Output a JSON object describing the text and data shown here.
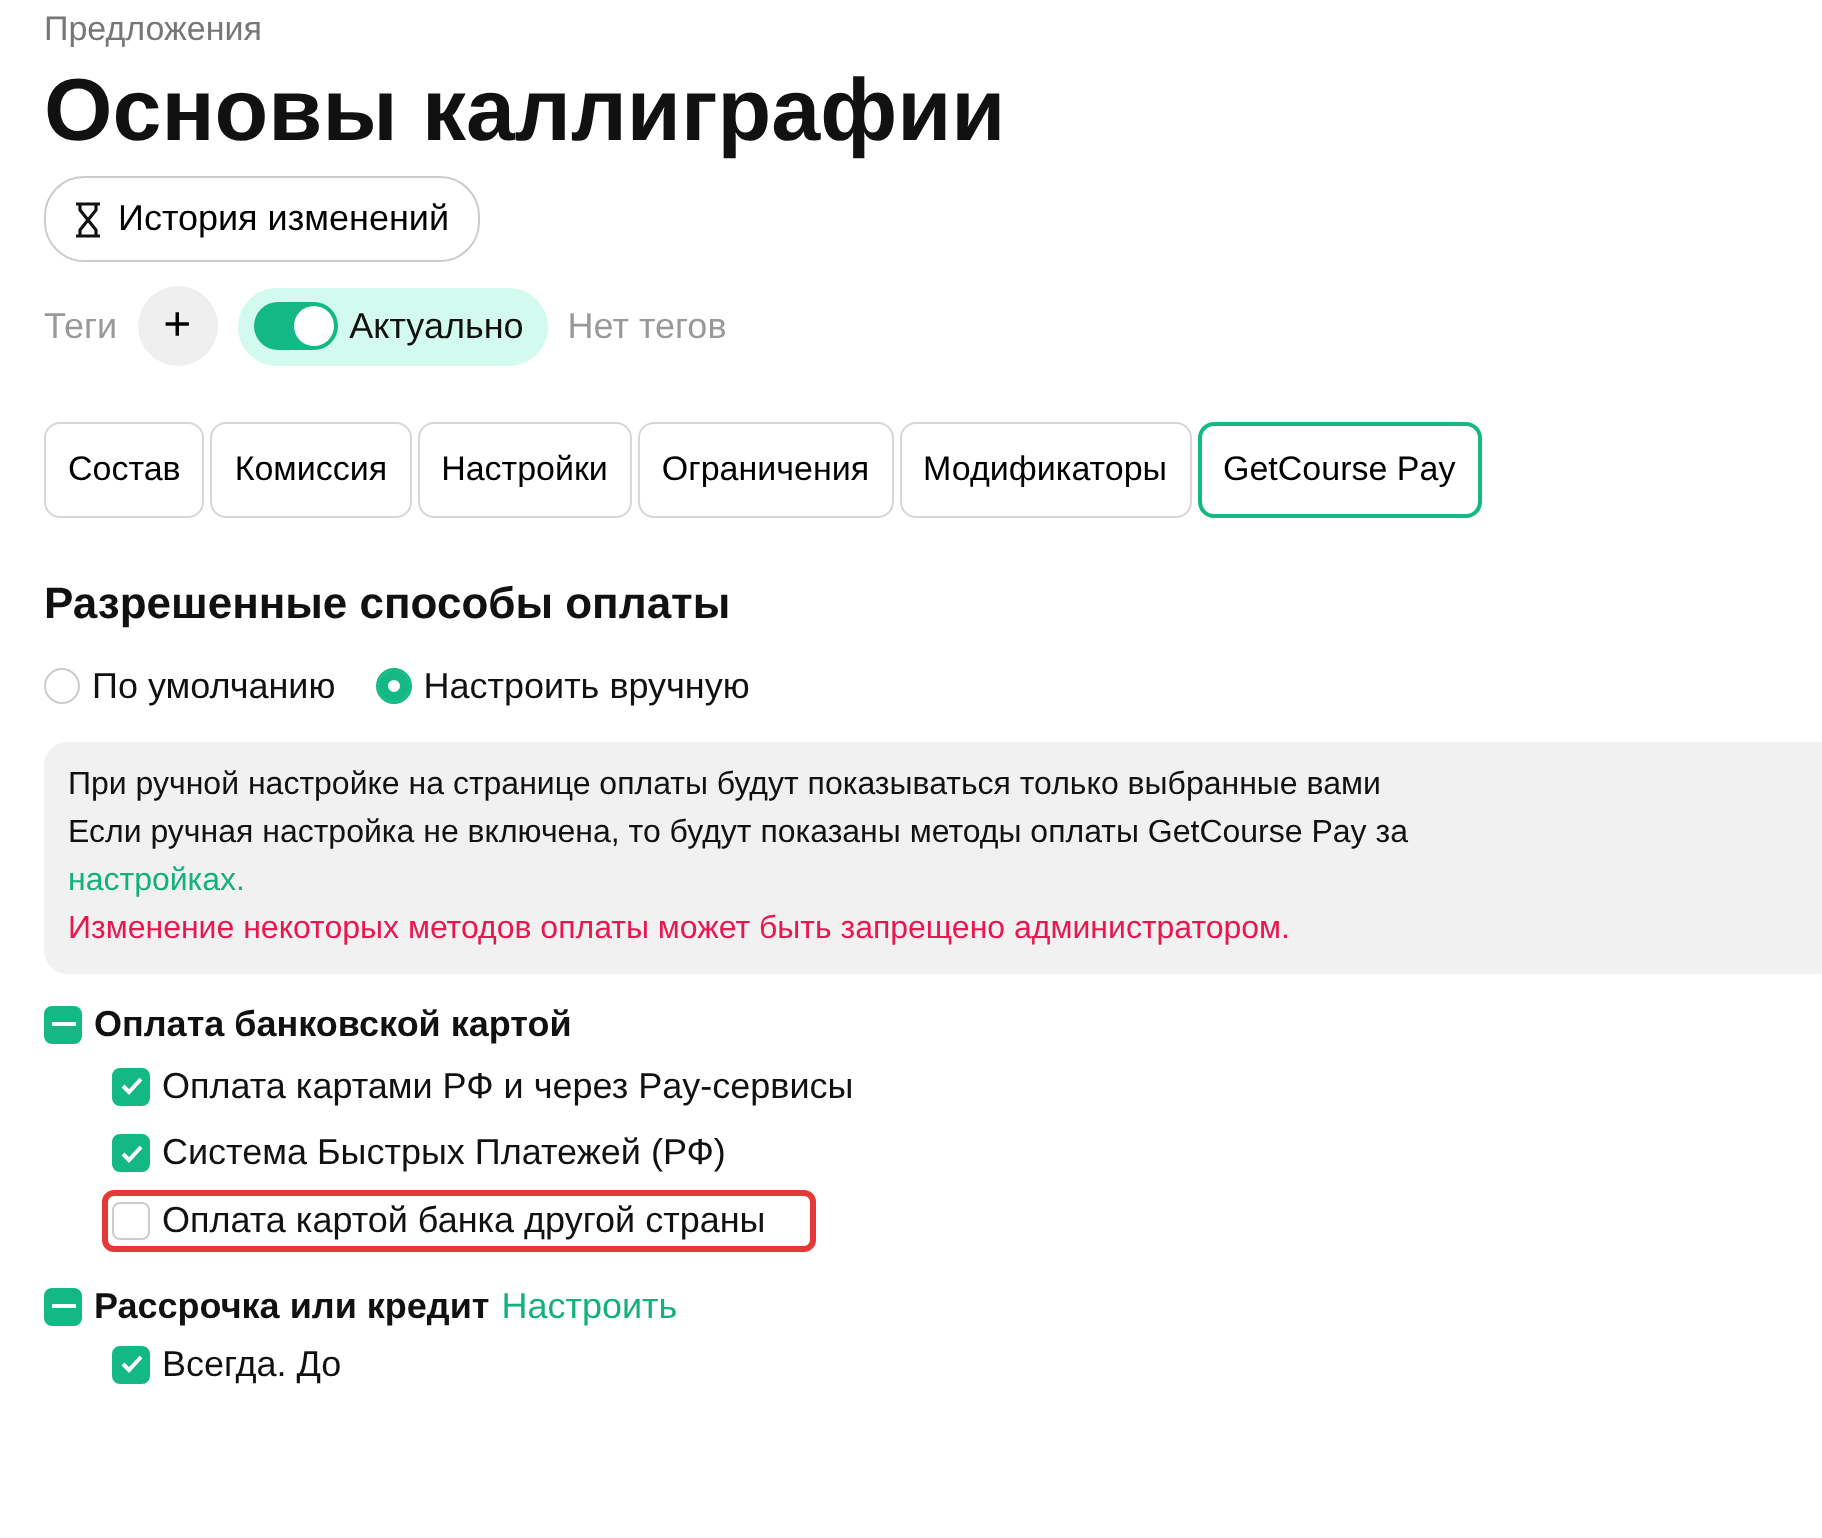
{
  "breadcrumb": "Предложения",
  "title": "Основы каллиграфии",
  "history_button": {
    "label": "История изменений"
  },
  "tags": {
    "label": "Теги",
    "add_button": "+",
    "toggle": {
      "label": "Актуально",
      "on": true
    },
    "empty_text": "Нет тегов"
  },
  "tabs": [
    {
      "label": "Состав",
      "selected": false
    },
    {
      "label": "Комиссия",
      "selected": false
    },
    {
      "label": "Настройки",
      "selected": false
    },
    {
      "label": "Ограничения",
      "selected": false
    },
    {
      "label": "Модификаторы",
      "selected": false
    },
    {
      "label": "GetCourse Pay",
      "selected": true
    }
  ],
  "section_title": "Разрешенные способы оплаты",
  "radios": [
    {
      "label": "По умолчанию",
      "selected": false
    },
    {
      "label": "Настроить вручную",
      "selected": true
    }
  ],
  "info": {
    "lines": [
      "При ручной настройке на странице оплаты будут показываться только выбранные вами",
      "Если ручная настройка не включена, то будут показаны методы оплаты GetCourse Pay за"
    ],
    "link": "настройках.",
    "warning": "Изменение некоторых методов оплаты может быть запрещено администратором."
  },
  "groups": [
    {
      "title": "Оплата банковской картой",
      "indeterminate": true,
      "items": [
        {
          "label": "Оплата картами РФ и через Pay-сервисы",
          "checked": true,
          "highlighted": false
        },
        {
          "label": "Система Быстрых Платежей (РФ)",
          "checked": true,
          "highlighted": false
        },
        {
          "label": "Оплата картой банка другой страны",
          "checked": false,
          "highlighted": true
        }
      ]
    },
    {
      "title": "Рассрочка или кредит",
      "action": "Настроить",
      "indeterminate": true,
      "items": [
        {
          "label": "Всегда. До",
          "checked": true,
          "highlighted": false
        }
      ]
    }
  ]
}
